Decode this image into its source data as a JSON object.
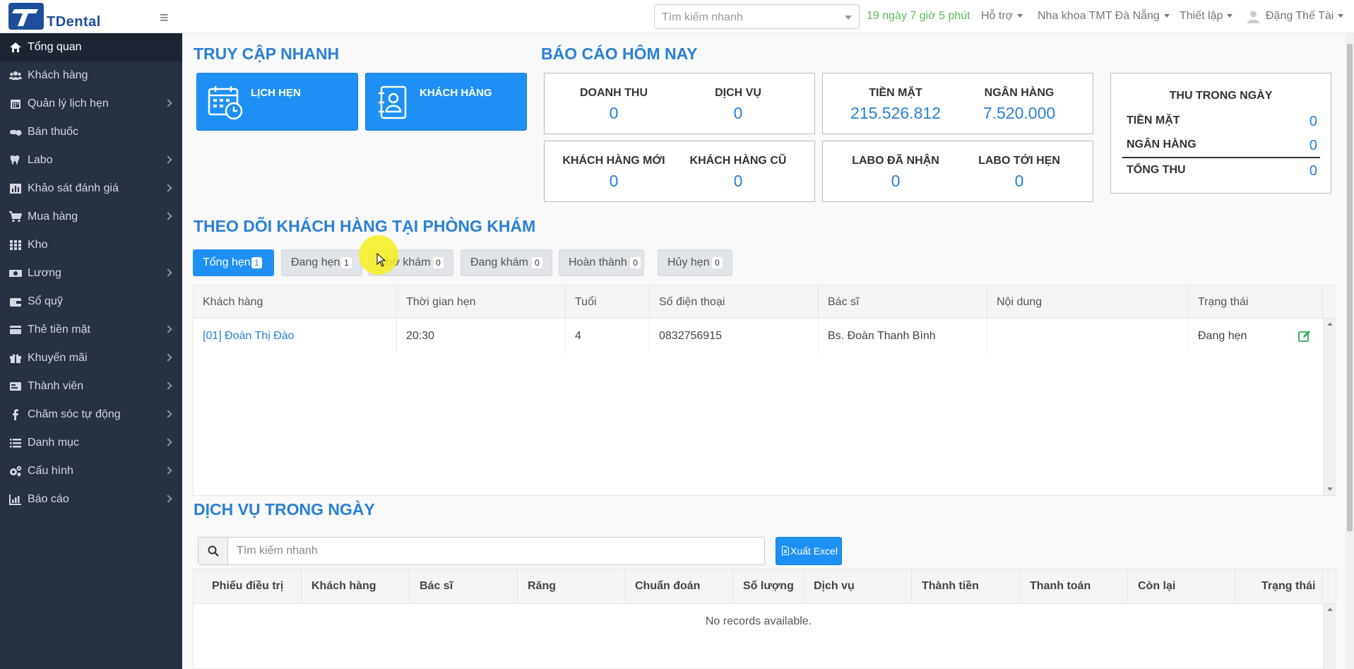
{
  "brand": {
    "name": "TDental",
    "logo_letter": "T"
  },
  "topbar": {
    "search_placeholder": "Tìm kiếm nhanh",
    "trial": "19 ngày 7 giờ 5 phút",
    "support": "Hỗ trợ",
    "clinic": "Nha khoa TMT Đà Nẵng",
    "settings": "Thiết lập",
    "user": "Đặng Thế Tài"
  },
  "sidebar": {
    "items": [
      {
        "label": "Tổng quan",
        "icon": "home-icon"
      },
      {
        "label": "Khách hàng",
        "icon": "users-icon"
      },
      {
        "label": "Quản lý lịch hẹn",
        "icon": "calendar-icon"
      },
      {
        "label": "Bán thuốc",
        "icon": "pills-icon"
      },
      {
        "label": "Labo",
        "icon": "tooth-icon"
      },
      {
        "label": "Khảo sát đánh giá",
        "icon": "chart-icon"
      },
      {
        "label": "Mua hàng",
        "icon": "cart-icon"
      },
      {
        "label": "Kho",
        "icon": "grid-icon"
      },
      {
        "label": "Lương",
        "icon": "money-icon"
      },
      {
        "label": "Sổ quỹ",
        "icon": "wallet-icon"
      },
      {
        "label": "Thẻ tiền mặt",
        "icon": "card-icon"
      },
      {
        "label": "Khuyến mãi",
        "icon": "gift-icon"
      },
      {
        "label": "Thành viên",
        "icon": "member-card-icon"
      },
      {
        "label": "Chăm sóc tự động",
        "icon": "facebook-icon"
      },
      {
        "label": "Danh mục",
        "icon": "list-icon"
      },
      {
        "label": "Cấu hình",
        "icon": "gears-icon"
      },
      {
        "label": "Báo cáo",
        "icon": "report-icon"
      }
    ]
  },
  "quick_access": {
    "title": "TRUY CẬP NHANH",
    "appointments": "LỊCH HẸN",
    "customers": "KHÁCH HÀNG"
  },
  "report": {
    "title": "BÁO CÁO HÔM NAY",
    "revenue_label": "DOANH THU",
    "revenue_value": "0",
    "service_label": "DỊCH VỤ",
    "service_value": "0",
    "cash_label": "TIỀN MẶT",
    "cash_value": "215.526.812",
    "bank_label": "NGÂN HÀNG",
    "bank_value": "7.520.000",
    "new_customers_label": "KHÁCH HÀNG MỚI",
    "new_customers_value": "0",
    "old_customers_label": "KHÁCH HÀNG CŨ",
    "old_customers_value": "0",
    "labo_received_label": "LABO ĐÃ NHẬN",
    "labo_received_value": "0",
    "labo_due_label": "LABO TỚI HẸN",
    "labo_due_value": "0",
    "income": {
      "title": "THU TRONG NGÀY",
      "cash_label": "TIỀN MẶT",
      "cash_value": "0",
      "bank_label": "NGÂN HÀNG",
      "bank_value": "0",
      "total_label": "TỔNG THU",
      "total_value": "0"
    }
  },
  "tracking": {
    "title": "THEO DÕI KHÁCH HÀNG TẠI PHÒNG KHÁM",
    "tabs": [
      {
        "label": "Tổng hẹn",
        "count": "1"
      },
      {
        "label": "Đang hẹn",
        "count": "1"
      },
      {
        "label": "Chờ khám",
        "count": "0"
      },
      {
        "label": "Đang khám",
        "count": "0"
      },
      {
        "label": "Hoàn thành",
        "count": "0"
      },
      {
        "label": "Hủy hẹn",
        "count": "0"
      }
    ],
    "columns": [
      "Khách hàng",
      "Thời gian hẹn",
      "Tuổi",
      "Số điện thoại",
      "Bác sĩ",
      "Nội dung",
      "Trạng thái"
    ],
    "rows": [
      {
        "customer": "[01] Đoàn Thị Đào",
        "time": "20:30",
        "age": "4",
        "phone": "0832756915",
        "doctor": "Bs. Đoàn Thanh Bình",
        "content": "",
        "status": "Đang hẹn"
      }
    ]
  },
  "services": {
    "title": "DỊCH VỤ TRONG NGÀY",
    "search_placeholder": "Tìm kiếm nhanh",
    "export_label": "Xuất Excel",
    "columns": [
      "Phiếu điều trị",
      "Khách hàng",
      "Bác sĩ",
      "Răng",
      "Chuẩn đoán",
      "Số lượng",
      "Dịch vụ",
      "Thành tiền",
      "Thanh toán",
      "Còn lại",
      "Trạng thái"
    ],
    "empty": "No records available."
  },
  "colors": {
    "accent": "#1e90f5",
    "title_blue": "#2a80d6",
    "sidebar_bg": "#273142",
    "trial_green": "#5cb85c"
  }
}
